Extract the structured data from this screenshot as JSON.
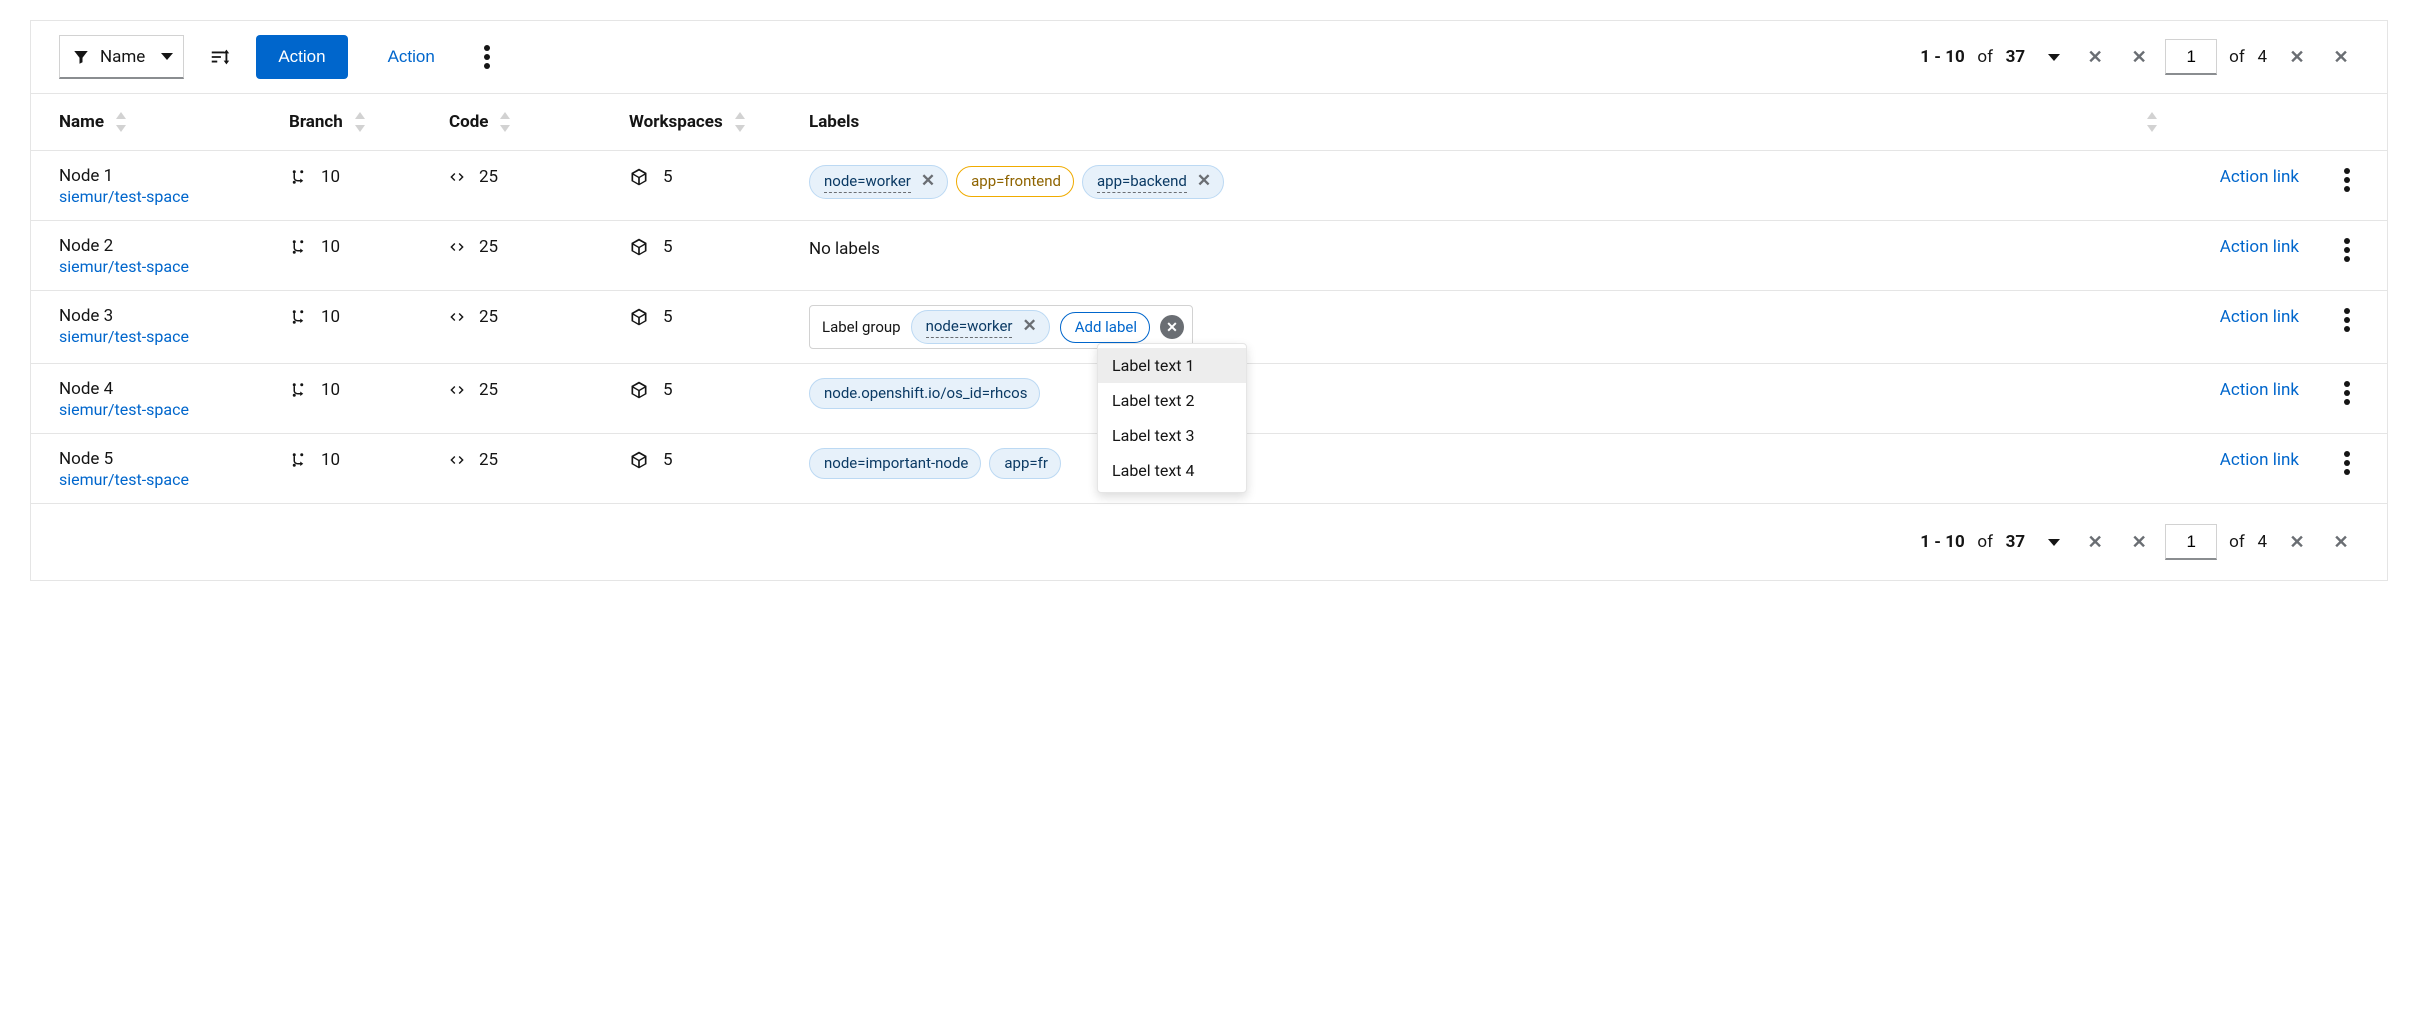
{
  "toolbar": {
    "filter_label": "Name",
    "primary_action": "Action",
    "link_action": "Action"
  },
  "pagination": {
    "range_start": "1",
    "range_end": "10",
    "total_items": "37",
    "of_label_items": "of",
    "page_input": "1",
    "of_label_pages": "of",
    "total_pages": "4"
  },
  "columns": {
    "name": "Name",
    "branch": "Branch",
    "code": "Code",
    "workspaces": "Workspaces",
    "labels": "Labels"
  },
  "dropdown": {
    "items": [
      "Label text 1",
      "Label text 2",
      "Label text 3",
      "Label text 4"
    ]
  },
  "rows": [
    {
      "name": "Node 1",
      "link": "siemur/test-space",
      "branch": "10",
      "code": "25",
      "workspaces": "5",
      "labels_mode": "chips",
      "labels": [
        {
          "kind": "blue-dashed",
          "text": "node=worker",
          "closable": true
        },
        {
          "kind": "orange",
          "text": "app=frontend",
          "closable": false
        },
        {
          "kind": "blue-dashed",
          "text": "app=backend",
          "closable": true
        }
      ],
      "action": "Action link"
    },
    {
      "name": "Node 2",
      "link": "siemur/test-space",
      "branch": "10",
      "code": "25",
      "workspaces": "5",
      "labels_mode": "none",
      "no_labels_text": "No labels",
      "action": "Action link"
    },
    {
      "name": "Node 3",
      "link": "siemur/test-space",
      "branch": "10",
      "code": "25",
      "workspaces": "5",
      "labels_mode": "group",
      "group_title": "Label group",
      "group_chip": {
        "kind": "blue-dashed",
        "text": "node=worker",
        "closable": true
      },
      "add_label_text": "Add label",
      "action": "Action link"
    },
    {
      "name": "Node 4",
      "link": "siemur/test-space",
      "branch": "10",
      "code": "25",
      "workspaces": "5",
      "labels_mode": "chips",
      "labels": [
        {
          "kind": "blue",
          "text": "node.openshift.io/os_id=rhcos",
          "closable": false
        }
      ],
      "action": "Action link"
    },
    {
      "name": "Node 5",
      "link": "siemur/test-space",
      "branch": "10",
      "code": "25",
      "workspaces": "5",
      "labels_mode": "chips",
      "labels": [
        {
          "kind": "blue",
          "text": "node=important-node",
          "closable": false
        },
        {
          "kind": "blue",
          "text": "app=fr",
          "closable": false
        }
      ],
      "action": "Action link"
    }
  ]
}
